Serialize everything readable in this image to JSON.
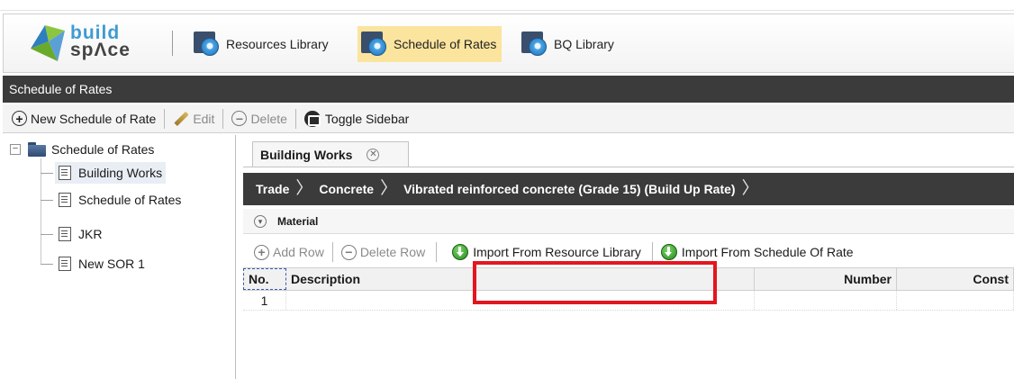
{
  "app": {
    "logo_top": "build",
    "logo_bottom": "spΛce",
    "tabs": [
      {
        "label": "Resources Library",
        "active": false
      },
      {
        "label": "Schedule of Rates",
        "active": true
      },
      {
        "label": "BQ Library",
        "active": false
      }
    ]
  },
  "title_bar": "Schedule of Rates",
  "toolbar": {
    "new_label": "New Schedule of Rate",
    "edit_label": "Edit",
    "delete_label": "Delete",
    "toggle_label": "Toggle Sidebar"
  },
  "sidebar": {
    "root": "Schedule of Rates",
    "items": [
      {
        "label": "Building Works"
      },
      {
        "label": "Schedule of Rates"
      },
      {
        "label": "JKR"
      },
      {
        "label": "New SOR 1"
      }
    ]
  },
  "content": {
    "tab_label": "Building Works",
    "breadcrumb": [
      "Trade",
      "Concrete",
      "Vibrated reinforced concrete (Grade 15) (Build Up Rate)"
    ],
    "section": "Material",
    "grid_toolbar": {
      "add_row": "Add Row",
      "delete_row": "Delete Row",
      "import_resource": "Import From Resource Library",
      "import_sor": "Import From Schedule Of Rate"
    },
    "grid": {
      "headers": [
        "No.",
        "Description",
        "Number",
        "Const"
      ],
      "rows": [
        [
          "1",
          "",
          "",
          ""
        ]
      ]
    }
  },
  "colors": {
    "accent_tab": "#fbe49d",
    "dark_bar": "#3b3b3b",
    "highlight": "#e3161e"
  }
}
